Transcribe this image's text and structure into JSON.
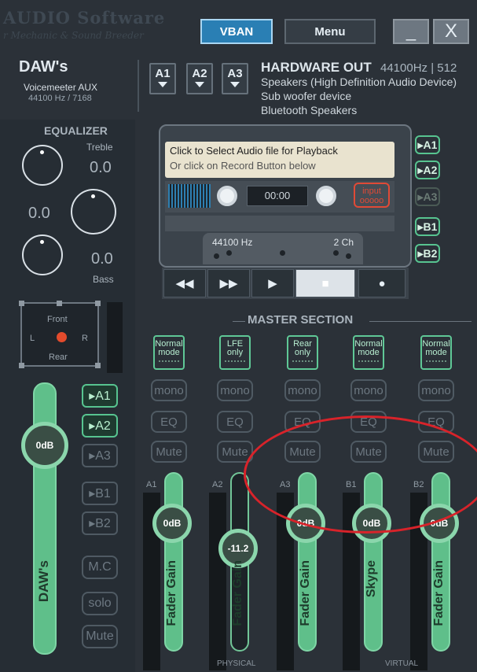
{
  "topbar": {
    "brand": "AUDIO Software",
    "brand_sub": "r Mechanic & Sound Breeder",
    "vban": "VBAN",
    "menu": "Menu",
    "minimize": "_",
    "close": "X"
  },
  "strip": {
    "title": "DAW's",
    "subtitle": "Voicemeeter AUX",
    "rate": "44100 Hz / 7168",
    "buses": [
      "A1",
      "A2",
      "A3"
    ]
  },
  "hardware_out": {
    "title": "HARDWARE OUT",
    "rate": "44100Hz | 512",
    "devices": [
      "Speakers (High Definition Audio Device)",
      "Sub woofer device",
      "Bluetooth Speakers"
    ]
  },
  "equalizer": {
    "title": "EQUALIZER",
    "treble_label": "Treble",
    "treble_value": "0.0",
    "mid_value": "0.0",
    "bass_value": "0.0",
    "bass_label": "Bass"
  },
  "pan": {
    "front": "Front",
    "rear": "Rear",
    "left": "L",
    "right": "R"
  },
  "left_fader": {
    "value": "0dB",
    "label": "DAW's",
    "routes": [
      "A1",
      "A2",
      "A3",
      "B1",
      "B2"
    ],
    "routes_active": [
      true,
      true,
      false,
      false,
      false
    ],
    "mc": "M.C",
    "solo": "solo",
    "mute": "Mute"
  },
  "player": {
    "line1": "Click to Select Audio file for Playback",
    "line2": "Or click on Record Button below",
    "time": "00:00",
    "input": "input",
    "input_sub": "ooooo",
    "sample_rate": "44100 Hz",
    "channels": "2 Ch"
  },
  "cassette_buses": [
    "A1",
    "A2",
    "A3",
    "B1",
    "B2"
  ],
  "transport": {
    "rewind": "◀◀",
    "forward": "▶▶",
    "play": "▶",
    "stop": "■",
    "record": "●"
  },
  "master": {
    "title": "MASTER SECTION",
    "physical": "PHYSICAL",
    "virtual": "VIRTUAL"
  },
  "channels": [
    {
      "bus": "A1",
      "mode": [
        "Normal",
        "mode"
      ],
      "mono": "mono",
      "eq": "EQ",
      "mute": "Mute",
      "gain": "0dB",
      "label": "Fader Gain"
    },
    {
      "bus": "A2",
      "mode": [
        "LFE",
        "only"
      ],
      "mono": "mono",
      "eq": "EQ",
      "mute": "Mute",
      "gain": "-11.2",
      "label": "Fader Gain"
    },
    {
      "bus": "A3",
      "mode": [
        "Rear",
        "only"
      ],
      "mono": "mono",
      "eq": "EQ",
      "mute": "Mute",
      "gain": "0dB",
      "label": "Fader Gain"
    },
    {
      "bus": "B1",
      "mode": [
        "Normal",
        "mode"
      ],
      "mono": "mono",
      "eq": "EQ",
      "mute": "Mute",
      "gain": "0dB",
      "label": "Skype"
    },
    {
      "bus": "B2",
      "mode": [
        "Normal",
        "mode"
      ],
      "mono": "mono",
      "eq": "EQ",
      "mute": "Mute",
      "gain": "0dB",
      "label": "Fader Gain"
    }
  ],
  "colors": {
    "accent_green": "#5fbf8a",
    "vban_blue": "#2a7fb4",
    "annotation_red": "#d8232a"
  }
}
